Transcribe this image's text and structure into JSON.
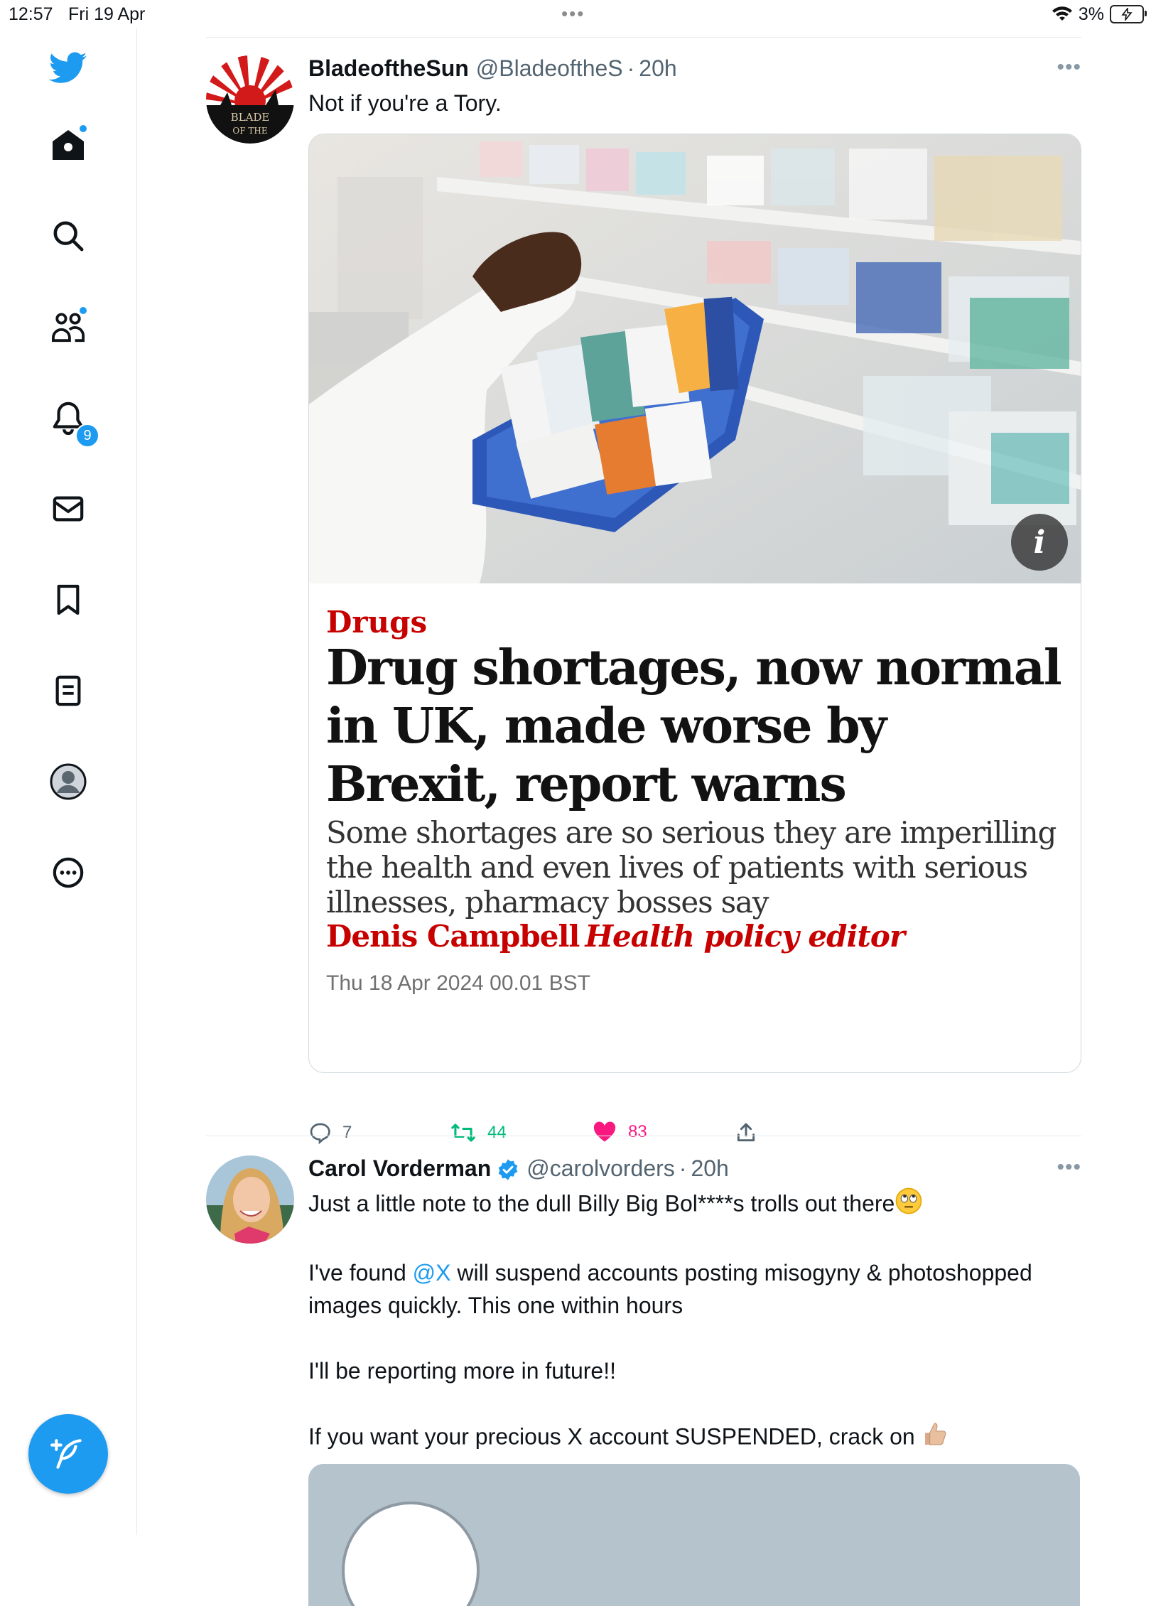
{
  "status_bar": {
    "time": "12:57",
    "date": "Fri 19 Apr",
    "battery": "3%"
  },
  "sidebar": {
    "notification_count": "9",
    "items": [
      {
        "name": "home"
      },
      {
        "name": "explore"
      },
      {
        "name": "communities"
      },
      {
        "name": "notifications"
      },
      {
        "name": "messages"
      },
      {
        "name": "bookmarks"
      },
      {
        "name": "lists"
      },
      {
        "name": "profile"
      },
      {
        "name": "more"
      }
    ]
  },
  "tweets": [
    {
      "name": "BladeoftheSun",
      "handle": "@BladeoftheS",
      "sep": "·",
      "time": "20h",
      "text": "Not if you're a Tory.",
      "avatar_text_1": "BLADE",
      "avatar_text_2": "OF THE",
      "article": {
        "kicker": "Drugs",
        "headline": "Drug shortages, now normal in UK, made worse by Brexit, report warns",
        "standfirst": "Some shortages are so serious they are imperilling the health and even lives of patients with serious illnesses, pharmacy bosses say",
        "byline_name": "Denis Campbell",
        "byline_role": "Health policy editor",
        "date": "Thu 18 Apr 2024 00.01 BST"
      },
      "stats": {
        "replies": "7",
        "retweets": "44",
        "likes": "83"
      }
    },
    {
      "name": "Carol Vorderman",
      "handle": "@carolvorders",
      "sep": "·",
      "time": "20h",
      "line1": "Just a little note to the dull Billy Big Bol****s trolls out there",
      "line2_pre": "I've found ",
      "line2_mention": "@X",
      "line2_post": " will suspend accounts posting misogyny & photoshopped images quickly. This one within hours",
      "line3": "I'll be reporting more in future!!",
      "line4": "If you want your precious X account SUSPENDED, crack on"
    }
  ],
  "colors": {
    "brand": "#1d9bf0",
    "retweet": "#00ba7c",
    "like": "#f91880",
    "guardian_red": "#c70000"
  }
}
